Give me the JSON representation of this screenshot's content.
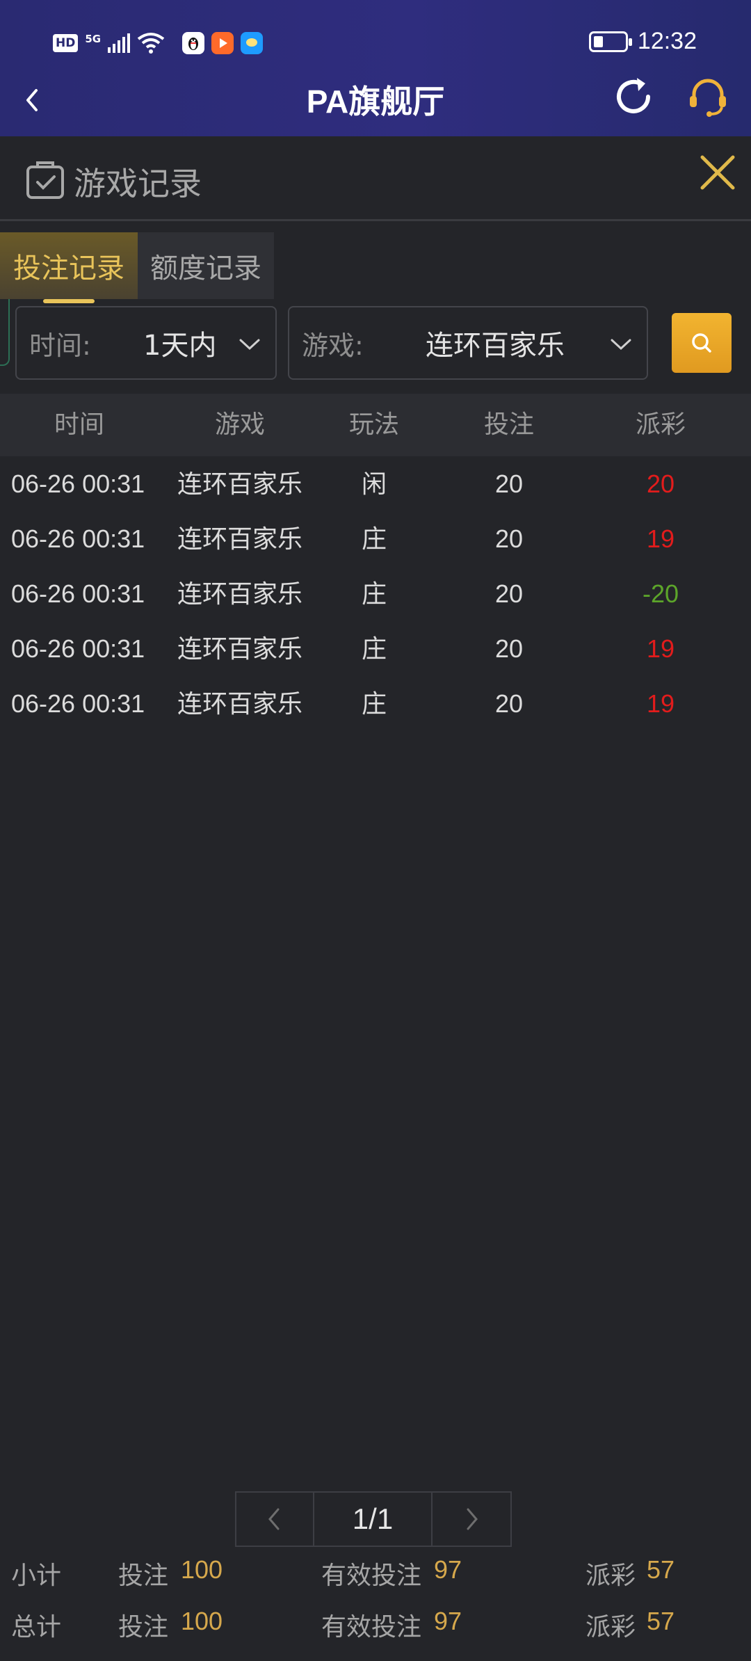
{
  "status_bar": {
    "network_badge": "HD",
    "network_type": "5G",
    "time": "12:32",
    "battery_level": 0.3
  },
  "header": {
    "title": "PA旗舰厅"
  },
  "panel": {
    "title": "游戏记录"
  },
  "tabs": [
    {
      "label": "投注记录",
      "active": true
    },
    {
      "label": "额度记录",
      "active": false
    }
  ],
  "filters": {
    "time": {
      "label": "时间:",
      "value": "1天内"
    },
    "game": {
      "label": "游戏:",
      "value": "连环百家乐"
    }
  },
  "table": {
    "columns": [
      "时间",
      "游戏",
      "玩法",
      "投注",
      "派彩"
    ],
    "rows": [
      {
        "time": "06-26 00:31",
        "game": "连环百家乐",
        "play": "闲",
        "bet": "20",
        "payout": "20"
      },
      {
        "time": "06-26 00:31",
        "game": "连环百家乐",
        "play": "庄",
        "bet": "20",
        "payout": "19"
      },
      {
        "time": "06-26 00:31",
        "game": "连环百家乐",
        "play": "庄",
        "bet": "20",
        "payout": "-20"
      },
      {
        "time": "06-26 00:31",
        "game": "连环百家乐",
        "play": "庄",
        "bet": "20",
        "payout": "19"
      },
      {
        "time": "06-26 00:31",
        "game": "连环百家乐",
        "play": "庄",
        "bet": "20",
        "payout": "19"
      }
    ]
  },
  "pagination": {
    "page_text": "1/1"
  },
  "summary": {
    "subtotal": {
      "label": "小计",
      "bet_label": "投注",
      "bet": "100",
      "valid_label": "有效投注",
      "valid": "97",
      "payout_label": "派彩",
      "payout": "57"
    },
    "total": {
      "label": "总计",
      "bet_label": "投注",
      "bet": "100",
      "valid_label": "有效投注",
      "valid": "97",
      "payout_label": "派彩",
      "payout": "57"
    }
  },
  "colors": {
    "accent_gold": "#e9c45a",
    "payout_positive": "#e21c1c",
    "payout_negative": "#5ca52a"
  },
  "icons": [
    "back-arrow-icon",
    "refresh-icon",
    "headset-icon",
    "clipboard-check-icon",
    "close-icon",
    "chevron-down-icon",
    "search-icon",
    "chevron-left-icon",
    "chevron-right-icon"
  ]
}
